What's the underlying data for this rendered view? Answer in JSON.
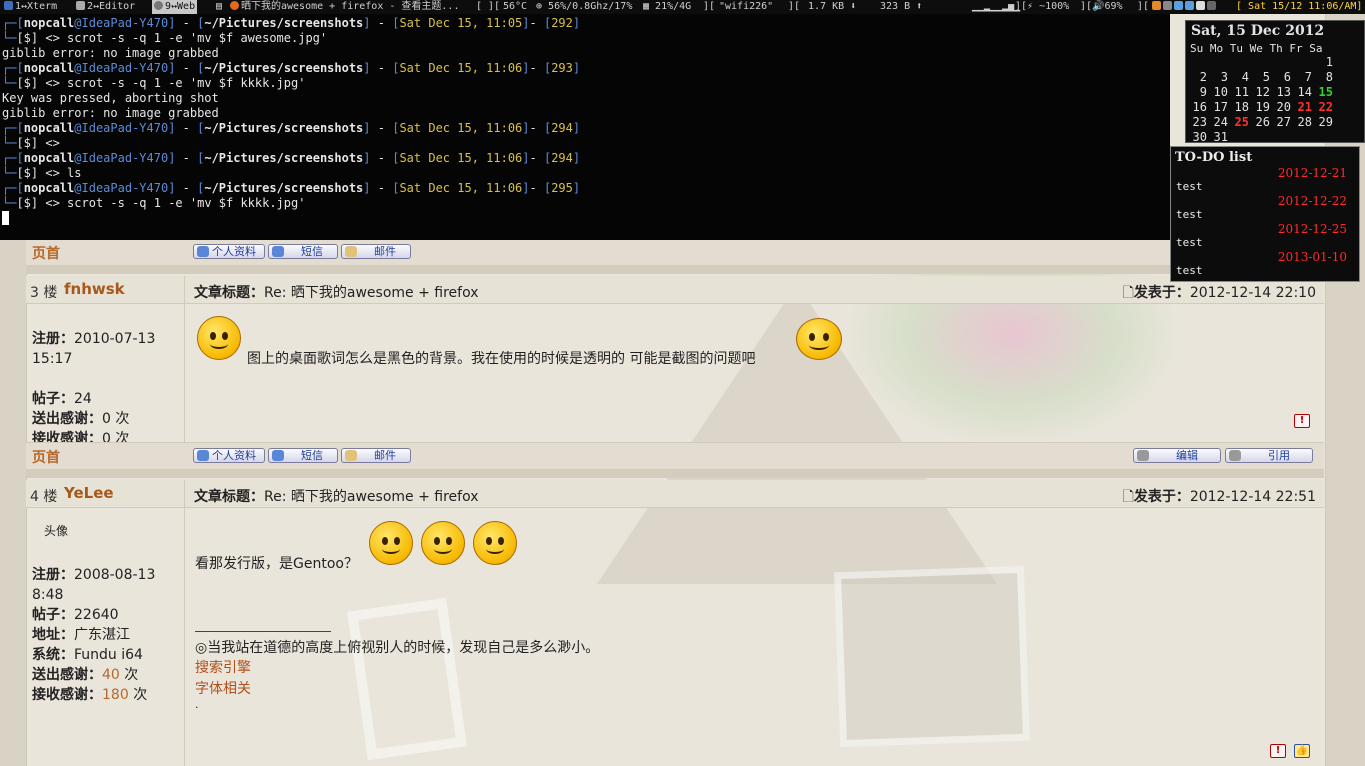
{
  "topbar": {
    "tags": [
      "1↔Xterm",
      "2↔Editor",
      "9↔Web"
    ],
    "window_title": "晒下我的awesome + firefox - 查看主题...",
    "temp": "56°C",
    "cpu": "56%/0.8Ghz/17%",
    "mem": "21%/4G",
    "wifi": "\"wifi226\"",
    "net_down": "1.7 KB",
    "net_up": "323 B",
    "battery": "~100%",
    "volume": "69%",
    "clock": "Sat 15/12 11:06/AM"
  },
  "terminal": {
    "prompts": [
      {
        "user": "nopcall",
        "host": "@IdeaPad-Y470",
        "path": "~/Pictures/screenshots",
        "date": "Sat Dec 15, 11:05",
        "num": "292",
        "cmd": "scrot -s -q 1 -e 'mv $f awesome.jpg'"
      },
      {
        "user": "nopcall",
        "host": "@IdeaPad-Y470",
        "path": "~/Pictures/screenshots",
        "date": "Sat Dec 15, 11:06",
        "num": "293",
        "cmd": "scrot -s -q 1 -e 'mv $f kkkk.jpg'"
      },
      {
        "user": "nopcall",
        "host": "@IdeaPad-Y470",
        "path": "~/Pictures/screenshots",
        "date": "Sat Dec 15, 11:06",
        "num": "294",
        "cmd": ""
      },
      {
        "user": "nopcall",
        "host": "@IdeaPad-Y470",
        "path": "~/Pictures/screenshots",
        "date": "Sat Dec 15, 11:06",
        "num": "294",
        "cmd": "ls"
      },
      {
        "user": "nopcall",
        "host": "@IdeaPad-Y470",
        "path": "~/Pictures/screenshots",
        "date": "Sat Dec 15, 11:06",
        "num": "295",
        "cmd": "scrot -s -q 1 -e 'mv $f kkkk.jpg'"
      }
    ],
    "output": {
      "err1": "giblib error: no image grabbed",
      "abort": "Key was pressed, aborting shot",
      "err2": "giblib error: no image grabbed"
    },
    "prompt_symbol": "[$] <>"
  },
  "calendar": {
    "title": "Sat, 15 Dec 2012",
    "weekdays": "Su Mo Tu We Th Fr Sa",
    "weeks": [
      [
        "",
        "",
        "",
        "",
        "",
        "",
        "1"
      ],
      [
        "2",
        "3",
        "4",
        "5",
        "6",
        "7",
        "8"
      ],
      [
        "9",
        "10",
        "11",
        "12",
        "13",
        "14",
        "15"
      ],
      [
        "16",
        "17",
        "18",
        "19",
        "20",
        "21",
        "22"
      ],
      [
        "23",
        "24",
        "25",
        "26",
        "27",
        "28",
        "29"
      ],
      [
        "30",
        "31",
        "",
        "",
        "",
        "",
        ""
      ]
    ],
    "today": "15",
    "marked": [
      "21",
      "22",
      "25"
    ]
  },
  "todo": {
    "title": "TO-DO list",
    "items": [
      {
        "date": "2012-12-21",
        "text": "test"
      },
      {
        "date": "2012-12-22",
        "text": "test"
      },
      {
        "date": "2012-12-25",
        "text": "test"
      },
      {
        "date": "2013-01-10",
        "text": "test"
      }
    ]
  },
  "forum": {
    "top_link": "页首",
    "btn_profile": "个人资料",
    "btn_pm": "短信",
    "btn_email": "邮件",
    "btn_edit": "编辑",
    "btn_quote": "引用",
    "posts": [
      {
        "floor": "3 楼",
        "user": "fnhwsk",
        "title_label": "文章标题：",
        "title": "Re: 晒下我的awesome + firefox",
        "posted_label": "发表于：",
        "posted": "2012-12-14 22:10",
        "reg_label": "注册：",
        "reg": "2010-07-13 15:17",
        "posts_label": "帖子：",
        "posts": "24",
        "thanks_sent_label": "送出感谢：",
        "thanks_sent": "0 次",
        "thanks_recv_label": "接收感谢：",
        "thanks_recv": "0 次",
        "body": "图上的桌面歌词怎么是黑色的背景。我在使用的时候是透明的 可能是截图的问题吧"
      },
      {
        "floor": "4 楼",
        "user": "YeLee",
        "avatar": "头像",
        "title_label": "文章标题：",
        "title": "Re: 晒下我的awesome + firefox",
        "posted_label": "发表于：",
        "posted": "2012-12-14 22:51",
        "reg_label": "注册：",
        "reg": "2008-08-13 8:48",
        "posts_label": "帖子：",
        "posts": "22640",
        "loc_label": "地址：",
        "loc": "广东湛江",
        "sys_label": "系统：",
        "sys": "Fundu i64",
        "thanks_sent_label": "送出感谢：",
        "thanks_sent": "40",
        "thanks_unit": "次",
        "thanks_recv_label": "接收感谢：",
        "thanks_recv": "180",
        "body": "看那发行版，是Gentoo？",
        "signature": "◎当我站在道德的高度上俯视别人的时候，发现自己是多么渺小。",
        "links": [
          "搜索引擎",
          "字体相关"
        ],
        "dot": "."
      }
    ]
  },
  "colors": {
    "accent_orange": "#b8682a",
    "term_blue": "#5b8bd7",
    "term_yellow": "#d9c148",
    "mark_red": "#ff3030",
    "today_green": "#35d12d"
  }
}
